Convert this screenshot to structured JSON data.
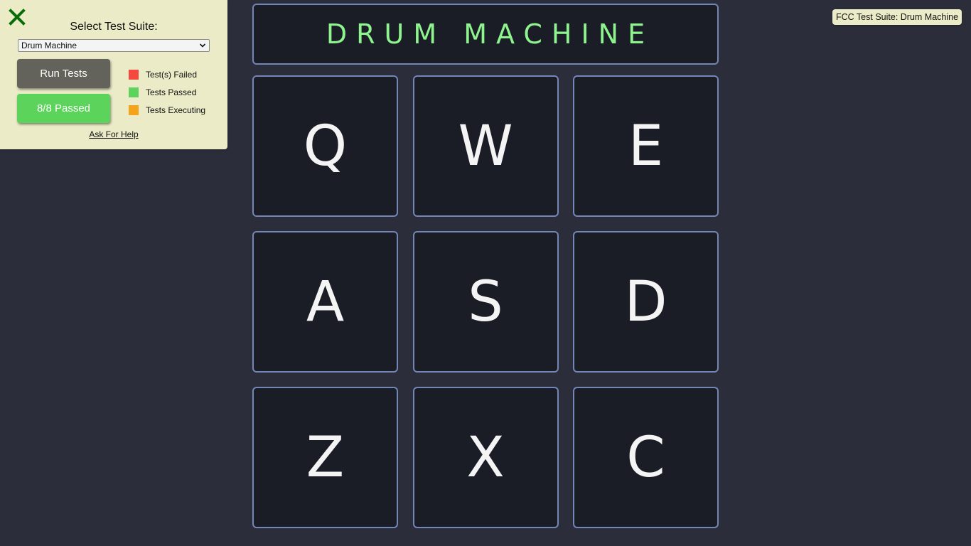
{
  "fcc_panel": {
    "title": "Select Test Suite:",
    "selected_suite": "Drum Machine",
    "run_tests_label": "Run Tests",
    "passed_label": "8/8 Passed",
    "legend": [
      {
        "label": "Test(s) Failed",
        "color": "#f4493f"
      },
      {
        "label": "Tests Passed",
        "color": "#5cd45c"
      },
      {
        "label": "Tests Executing",
        "color": "#f5a31a"
      }
    ],
    "help_label": "Ask For Help",
    "close_icon": "close-icon",
    "close_color": "#0a6b0a"
  },
  "suite_badge": "FCC Test Suite: Drum Machine",
  "drum": {
    "display_text": "DRUM MACHINE",
    "pads": [
      "Q",
      "W",
      "E",
      "A",
      "S",
      "D",
      "Z",
      "X",
      "C"
    ]
  },
  "colors": {
    "background": "#2b2d3a",
    "pad_background": "#1b1d26",
    "pad_border": "#7486b6",
    "display_text": "#8ef58e",
    "panel_background": "#ebebc8"
  }
}
